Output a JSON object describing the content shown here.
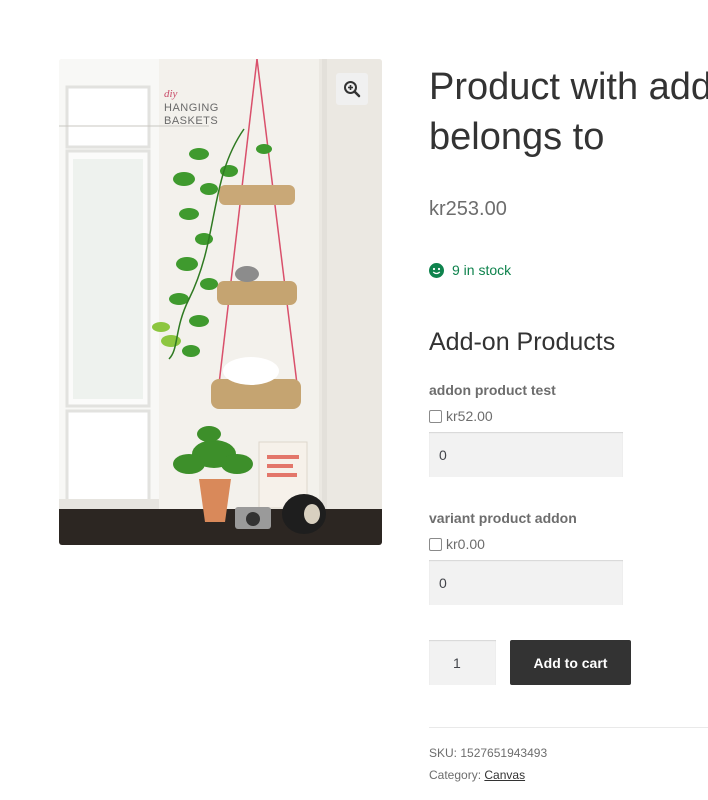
{
  "gallery": {
    "caption_small": "diy",
    "caption_line1": "HANGING",
    "caption_line2": "BASKETS",
    "zoom_icon": "magnifier-plus-icon"
  },
  "product": {
    "title_line1": "Product with addo",
    "title_line2": "belongs to",
    "price": "kr253.00",
    "stock_icon": "smiley-icon",
    "stock_text": "9 in stock"
  },
  "addons": {
    "heading": "Add-on Products",
    "items": [
      {
        "name": "addon product test",
        "price": "kr52.00",
        "qty": "0"
      },
      {
        "name": "variant product addon",
        "price": "kr0.00",
        "qty": "0"
      }
    ]
  },
  "cart": {
    "qty": "1",
    "button_label": "Add to cart"
  },
  "meta": {
    "sku_label": "SKU:",
    "sku_value": "1527651943493",
    "category_label": "Category:",
    "category_value": "Canvas"
  },
  "colors": {
    "stock_green": "#0f834d",
    "button_dark": "#333333",
    "field_bg": "#f2f2f2"
  }
}
